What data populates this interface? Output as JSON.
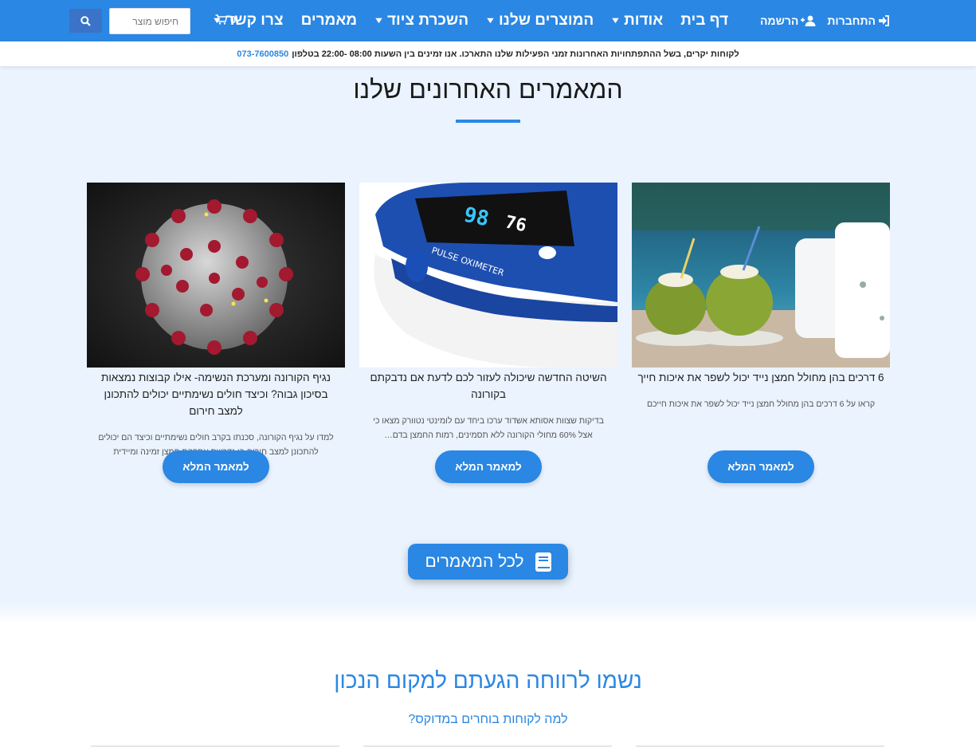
{
  "header": {
    "nav": [
      {
        "label": "דף בית",
        "has_dropdown": false
      },
      {
        "label": "אודות",
        "has_dropdown": true
      },
      {
        "label": "המוצרים שלנו",
        "has_dropdown": true
      },
      {
        "label": "השכרת ציוד",
        "has_dropdown": true
      },
      {
        "label": "מאמרים",
        "has_dropdown": false
      },
      {
        "label": "צרו קשר",
        "has_dropdown": true
      }
    ],
    "login_label": "התחברות",
    "register_label": "הרשמה",
    "cart_count": "0",
    "search_placeholder": "חיפוש מוצר"
  },
  "notice": {
    "text": "לקוחות יקרים, בשל ההתפתחויות האחרונות זמני הפעילות שלנו התארכו. אנו זמינים בין השעות 08:00 -22:00 בטלפון",
    "phone": "073-7600850"
  },
  "articles": {
    "title": "המאמרים האחרונים שלנו",
    "cards": [
      {
        "title": "6 דרכים בהן מחולל חמצן נייד יכול לשפר את איכות חייך",
        "excerpt": "קראו על 6 דרכים בהן מחולל חמצן נייד יכול לשפר את איכות חייכם",
        "button": "למאמר המלא"
      },
      {
        "title": "השיטה החדשה שיכולה לעזור לכם לדעת אם נדבקתם בקורונה",
        "excerpt": "בדיקות שצוות אסותא אשדוד ערכו ביחד עם לומינטי נטוורק מצאו כי אצל 60% מחולי הקורונה ללא תסמינים, רמות החמצן בדם…",
        "button": "למאמר המלא"
      },
      {
        "title": "נגיף הקורונה ומערכת הנשימה- אילו קבוצות נמצאות בסיכון גבוה? וכיצד חולים נשימתיים יכולים להתכונן למצב חירום",
        "excerpt": "למדו על נגיף הקורונה, סכנתו בקרב חולים נשימתיים וכיצד הם יכולים להתכונן למצב חירום בו נדרשת אספקת חמצן זמינה ומיידית",
        "button": "למאמר המלא"
      }
    ],
    "all_button": "לכל המאמרים",
    "oximeter_screen": {
      "spo2": "98",
      "bpm": "76",
      "device_label": "PULSE OXIMETER"
    }
  },
  "section2": {
    "title": "נשמו לרווחה הגעתם למקום הנכון",
    "subtitle": "למה לקוחות בוחרים במדוקס?"
  },
  "colors": {
    "primary": "#2a87e3",
    "page_bg": "#eaf3fe",
    "search_button": "#3a73c8"
  },
  "icons": {
    "login": "sign-in-icon",
    "register": "user-plus-icon",
    "cart": "cart-icon",
    "search": "search-icon",
    "dropdown": "chevron-down-icon",
    "all_articles": "book-icon"
  }
}
